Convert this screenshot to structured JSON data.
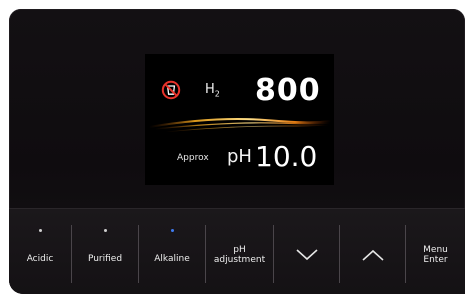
{
  "display": {
    "h2_label": "H",
    "h2_sub": "2",
    "h2_value": "800",
    "approx_label": "Approx",
    "ph_label": "pH",
    "ph_value": "10.0",
    "status_icon": "no-cup-icon",
    "accent_color": "#e8332b"
  },
  "buttons": [
    {
      "label": "Acidic",
      "icon": "indicator-dot"
    },
    {
      "label": "Purified",
      "icon": "indicator-dot"
    },
    {
      "label": "Alkaline",
      "icon": "indicator-dot",
      "active": true
    },
    {
      "label_line1": "pH",
      "label_line2": "adjustment"
    },
    {
      "icon": "chevron-down-icon"
    },
    {
      "icon": "chevron-up-icon"
    },
    {
      "label_line1": "Menu",
      "label_line2": "Enter"
    }
  ],
  "colors": {
    "active_indicator": "#3f7cf0",
    "panel": "#131013"
  }
}
